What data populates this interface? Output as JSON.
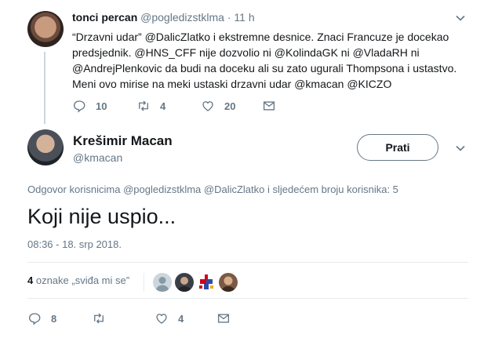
{
  "parent_tweet": {
    "author_name": "tonci percan",
    "meta": "@pogledizstklma · 11 h",
    "text_lines": [
      "“Drzavni udar” @DalicZlatko i ekstremne desnice. Znaci Francuze je docekao",
      "predsjednik. @HNS_CFF nije dozvolio ni @KolindaGK ni @VladaRH ni",
      "@AndrejPlenkovic da budi na doceku ali su zato ugurali Thompsona i ustastvo.",
      "Meni ovo mirise na meki ustaski drzavni udar @kmacan @KICZO"
    ],
    "actions": {
      "reply_count": "10",
      "retweet_count": "4",
      "like_count": "20"
    }
  },
  "main_tweet": {
    "author_name": "Krešimir Macan",
    "handle": "@kmacan",
    "follow_label": "Prati",
    "replying_to": "Odgovor korisnicima @pogledizstklma @DalicZlatko i sljedećem broju korisnika: 5",
    "text": "Koji nije uspio...",
    "timestamp": "08:36 - 18. srp 2018.",
    "likes": {
      "count": "4",
      "label": " oznake „sviđa mi se”"
    },
    "actions": {
      "reply_count": "8",
      "retweet_count": "",
      "like_count": "4"
    }
  },
  "icons": {
    "reply": "reply-icon",
    "retweet": "retweet-icon",
    "like": "heart-icon",
    "message": "envelope-icon",
    "menu": "chevron-down-icon"
  },
  "colors": {
    "text": "#14171a",
    "secondary": "#657786",
    "divider": "#e6ecf0"
  }
}
